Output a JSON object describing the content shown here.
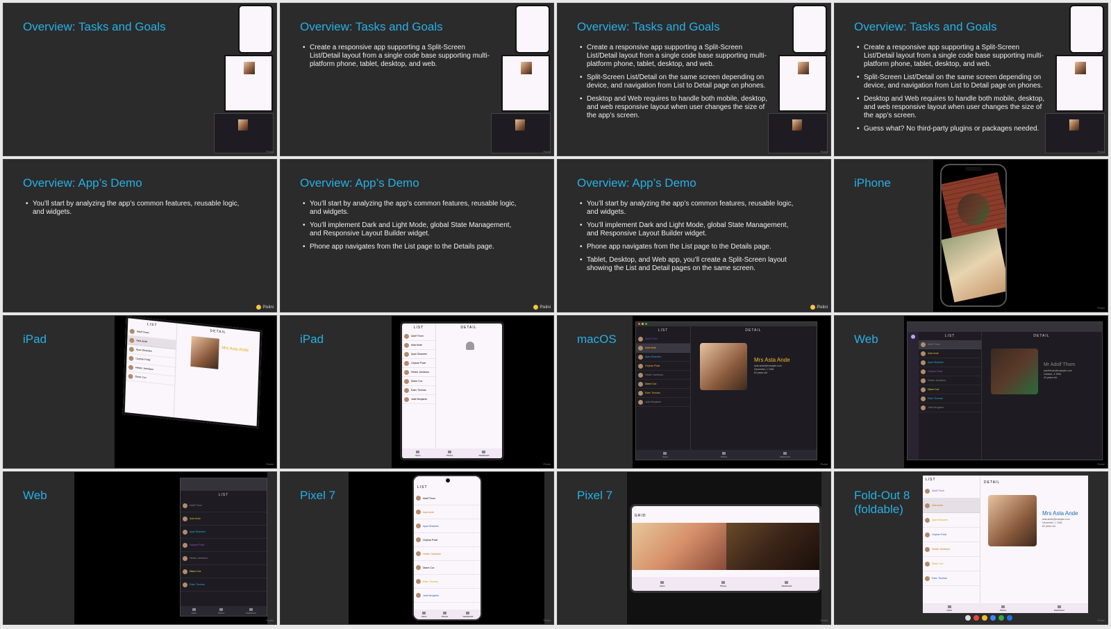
{
  "slides": {
    "s1": {
      "title": "Overview: Tasks and Goals"
    },
    "s2": {
      "title": "Overview: Tasks and Goals",
      "bullets": [
        "Create a responsive app supporting a Split-Screen List/Detail layout from a single code base supporting multi-platform phone, tablet, desktop, and web."
      ]
    },
    "s3": {
      "title": "Overview: Tasks and Goals",
      "bullets": [
        "Create a responsive app supporting a Split-Screen List/Detail layout from a single code base supporting multi-platform phone, tablet, desktop, and web.",
        "Split-Screen List/Detail on the same screen depending on device, and navigation from List to Detail page on phones.",
        "Desktop and Web requires to handle both mobile, desktop, and web responsive layout when user changes the size of the app’s screen."
      ]
    },
    "s4": {
      "title": "Overview: Tasks and Goals",
      "bullets": [
        "Create a responsive app supporting a Split-Screen List/Detail layout from a single code base supporting multi-platform phone, tablet, desktop, and web.",
        "Split-Screen List/Detail on the same screen depending on device, and navigation from List to Detail page on phones.",
        "Desktop and Web requires to handle both mobile, desktop, and web responsive layout when user changes the size of the app’s screen.",
        "Guess what? No third-party plugins or packages needed."
      ]
    },
    "s5": {
      "title": "Overview: App’s Demo",
      "bullets": [
        "You’ll start by analyzing the app’s common features, reusable logic, and widgets."
      ]
    },
    "s6": {
      "title": "Overview: App’s Demo",
      "bullets": [
        "You’ll start by analyzing the app’s common features, reusable logic, and widgets.",
        "You’ll implement Dark and Light Mode, global State Management, and Responsive Layout Builder widget.",
        "Phone app navigates from the List page to the Details page."
      ]
    },
    "s7": {
      "title": "Overview: App’s Demo",
      "bullets": [
        "You’ll start by analyzing the app’s common features, reusable logic, and widgets.",
        "You’ll implement Dark and Light Mode, global State Management, and Responsive Layout Builder widget.",
        "Phone app navigates from the List page to the Details page.",
        "Tablet, Desktop, and Web app, you’ll create a Split-Screen layout showing the List and Detail pages on the same screen."
      ]
    },
    "s8": {
      "title": "iPhone"
    },
    "s9": {
      "title": "iPad"
    },
    "s10": {
      "title": "iPad"
    },
    "s11": {
      "title": "macOS"
    },
    "s12": {
      "title": "Web"
    },
    "s13": {
      "title": "Web"
    },
    "s14": {
      "title": "Pixel 7"
    },
    "s15": {
      "title": "Pixel 7"
    },
    "s16": {
      "title": "Fold-Out 8\n(foldable)"
    }
  },
  "brand": "Pixlini",
  "app": {
    "list_header": "LIST",
    "detail_header": "DETAIL",
    "grid_header": "GRID",
    "nav": [
      "Users",
      "Photos",
      "Dashboard"
    ],
    "people": [
      "Adolf Thom",
      "Asta Ande",
      "Ayan Dhanden",
      "Ceyhan Polat",
      "Hester Jamieson",
      "Diane Cox",
      "Eden Thomas",
      "Jade Benjamin"
    ],
    "detail_asta": {
      "name": "Mrs Asta Ande",
      "email": "asta.ande@example.com",
      "dob": "December, 1 1961",
      "age": "62 years old"
    },
    "detail_adolf": {
      "name": "Mr Adolf Thom",
      "email": "adolf.thom@example.com",
      "dob": "October, 4 1995",
      "age": "43 years old"
    }
  },
  "colors": {
    "title": "#27b0e6",
    "slide_bg": "#2b2b2b",
    "accent_name": "#f5b82e"
  }
}
